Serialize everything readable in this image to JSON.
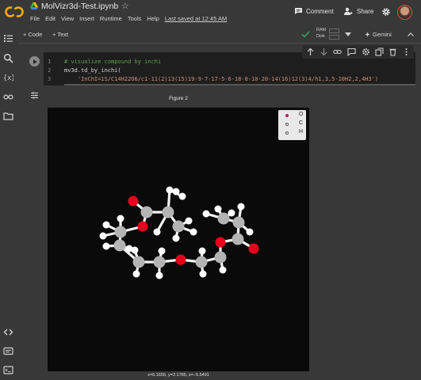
{
  "header": {
    "notebook_name": "MolVizr3d-Test.ipynb",
    "menu": [
      "File",
      "Edit",
      "View",
      "Insert",
      "Runtime",
      "Tools",
      "Help"
    ],
    "last_saved": "Last saved at 12:45 AM",
    "comment_label": "Comment",
    "share_label": "Share"
  },
  "toolbar": {
    "add_code_label": "+ Code",
    "add_text_label": "+ Text",
    "ram_label": "RAM",
    "disk_label": "Disk",
    "gemini_label": "Gemini"
  },
  "cell": {
    "line_numbers": [
      "1",
      "2",
      "3"
    ],
    "line1": "# visualize compound by inchi",
    "line2": "mv3d.td_by_inchi(",
    "line3": "    'InChI=1S/C14H22O6/c1-11(2)13(15)19-9-7-17-5-6-18-8-10-20-14(16)12(3)4/h1,3,5-10H2,2,4H3')"
  },
  "figure": {
    "title": "Figure 2",
    "legend": [
      {
        "label": "O",
        "color": "#e8001c"
      },
      {
        "label": "C",
        "color": "#b0b0b0"
      },
      {
        "label": "H",
        "color": "#ffffff"
      }
    ],
    "coords_readout": "x=6.1656, y=2.1785, z=−5.5491"
  }
}
